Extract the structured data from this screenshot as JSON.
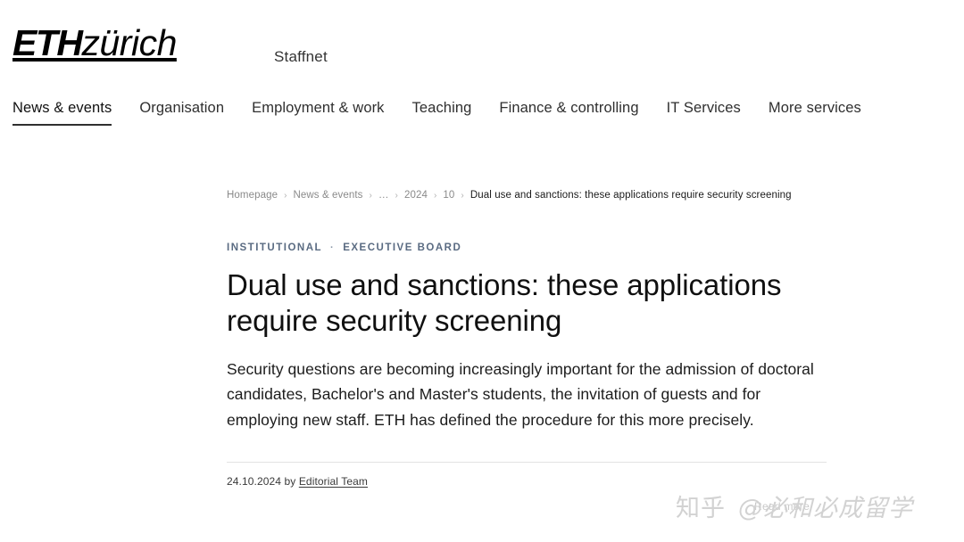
{
  "site": {
    "logo_eth": "ETH",
    "logo_zurich": "zürich",
    "portal_name": "Staffnet"
  },
  "nav": {
    "items": [
      {
        "label": "News & events",
        "active": true
      },
      {
        "label": "Organisation",
        "active": false
      },
      {
        "label": "Employment & work",
        "active": false
      },
      {
        "label": "Teaching",
        "active": false
      },
      {
        "label": "Finance & controlling",
        "active": false
      },
      {
        "label": "IT Services",
        "active": false
      },
      {
        "label": "More services",
        "active": false
      }
    ]
  },
  "breadcrumb": {
    "separator": "›",
    "items": [
      {
        "label": "Homepage",
        "current": false
      },
      {
        "label": "News & events",
        "current": false
      },
      {
        "label": "…",
        "current": false
      },
      {
        "label": "2024",
        "current": false
      },
      {
        "label": "10",
        "current": false
      },
      {
        "label": "Dual use and sanctions: these applications require security screening",
        "current": true
      }
    ]
  },
  "article": {
    "categories": [
      "INSTITUTIONAL",
      "EXECUTIVE BOARD"
    ],
    "category_separator": "·",
    "headline": "Dual use and sanctions: these applications require security screening",
    "lead": "Security questions are becoming increasingly important for the admission of doctoral candidates, Bachelor's and Master's students, the invitation of guests and for employing new staff. ETH has defined the procedure for this more precisely.",
    "date": "24.10.2024",
    "byline_prefix": "by",
    "author": "Editorial Team",
    "ghost_text": "Read more"
  },
  "watermark": {
    "brand": "知乎",
    "handle": "@必和必成留学"
  },
  "colors": {
    "accent_category": "#5a6b82",
    "text_primary": "#101010",
    "text_muted": "#8a8a8a",
    "divider": "#e2e2e2",
    "watermark": "#d2d2d2"
  }
}
